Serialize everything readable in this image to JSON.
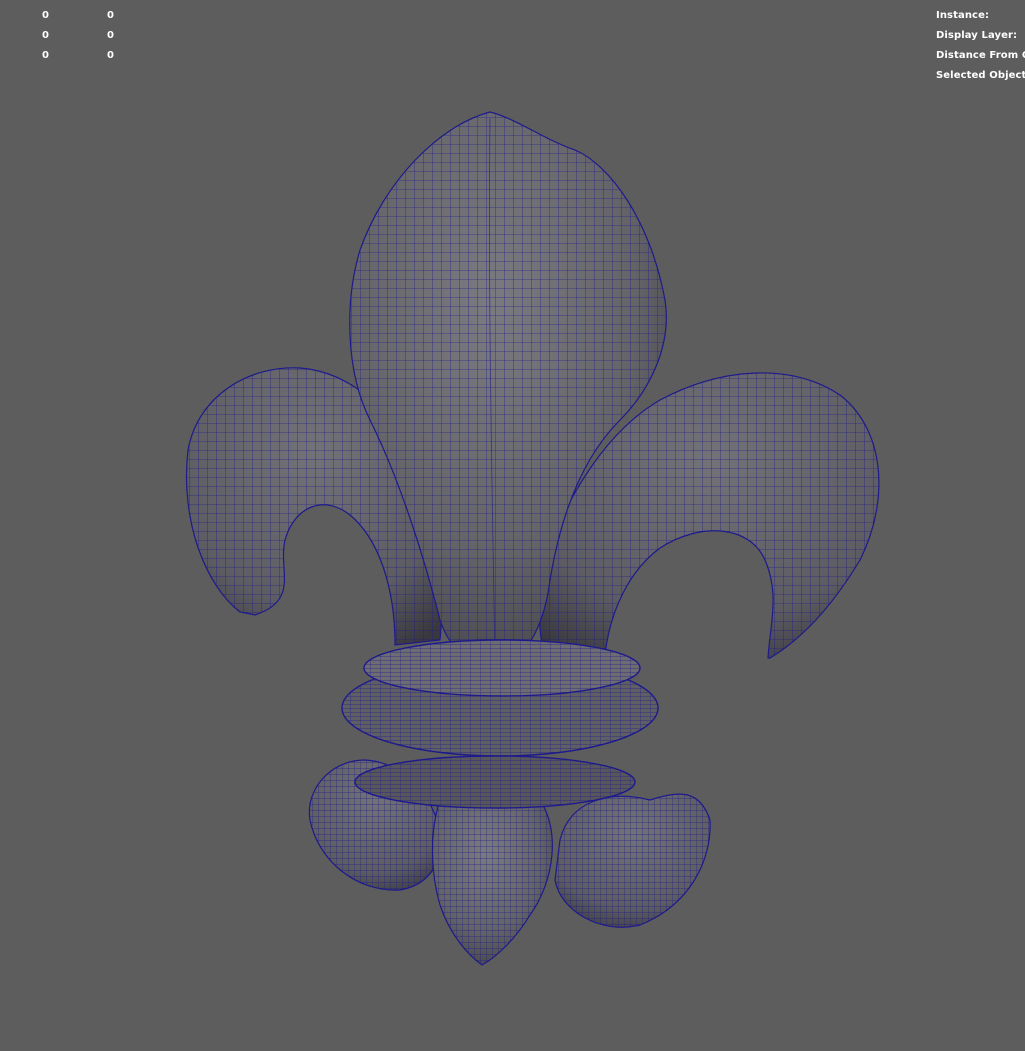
{
  "heads_up_display": {
    "left_rows": [
      {
        "col1": "0",
        "col2": "0"
      },
      {
        "col1": "0",
        "col2": "0"
      },
      {
        "col1": "0",
        "col2": "0"
      }
    ],
    "right_labels": [
      "Instance:",
      "Display Layer:",
      "Distance From Cam",
      "Selected Objects:"
    ]
  },
  "viewport": {
    "background_color": "#5d5d5d",
    "wireframe_color": "#1e1a8c",
    "shaded_color": "#6a6a6e",
    "model_icon": "fleur-de-lis-wireframe-mesh"
  }
}
